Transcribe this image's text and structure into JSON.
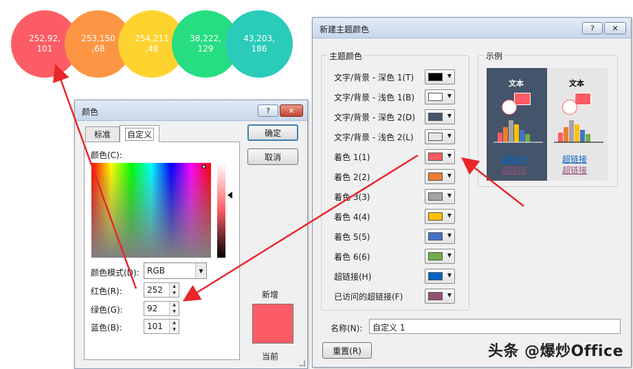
{
  "circles": [
    {
      "label": "252,92,\n101",
      "color": "#fc5c65"
    },
    {
      "label": "253,150\n,68",
      "color": "#fd9644"
    },
    {
      "label": "254,211\n,48",
      "color": "#fed330"
    },
    {
      "label": "38,222,\n129",
      "color": "#26de81"
    },
    {
      "label": "43,203,\n186",
      "color": "#2bcbba"
    }
  ],
  "color_dialog": {
    "title": "颜色",
    "help": "?",
    "close": "✕",
    "tabs": [
      "标准",
      "自定义"
    ],
    "colors_label": "颜色(C):",
    "mode_label": "颜色模式(D):",
    "mode_value": "RGB",
    "red_label": "红色(R):",
    "red_value": "252",
    "green_label": "绿色(G):",
    "green_value": "92",
    "blue_label": "蓝色(B):",
    "blue_value": "101",
    "ok": "确定",
    "cancel": "取消",
    "new_label": "新增",
    "current_label": "当前",
    "preview_color": "#fc5c65"
  },
  "theme_dialog": {
    "title": "新建主题颜色",
    "help": "?",
    "close": "✕",
    "group_label": "主题颜色",
    "rows": [
      {
        "label": "文字/背景 - 深色 1(T)",
        "color": "#000000"
      },
      {
        "label": "文字/背景 - 浅色 1(B)",
        "color": "#ffffff"
      },
      {
        "label": "文字/背景 - 深色 2(D)",
        "color": "#44546a"
      },
      {
        "label": "文字/背景 - 浅色 2(L)",
        "color": "#e7e6e6"
      },
      {
        "label": "着色 1(1)",
        "color": "#fc5c65"
      },
      {
        "label": "着色 2(2)",
        "color": "#ed7d31"
      },
      {
        "label": "着色 3(3)",
        "color": "#a5a5a5"
      },
      {
        "label": "着色 4(4)",
        "color": "#ffc000"
      },
      {
        "label": "着色 5(5)",
        "color": "#4472c4"
      },
      {
        "label": "着色 6(6)",
        "color": "#70ad47"
      },
      {
        "label": "超链接(H)",
        "color": "#0563c1"
      },
      {
        "label": "已访问的超链接(F)",
        "color": "#954f72"
      }
    ],
    "sample_label": "示例",
    "sample_text": "文本",
    "sample_link": "超链接",
    "sample_visited": "超链接",
    "name_label": "名称(N):",
    "name_value": "自定义 1",
    "reset": "重置(R)"
  },
  "watermark": "头条 @爆炒Office"
}
